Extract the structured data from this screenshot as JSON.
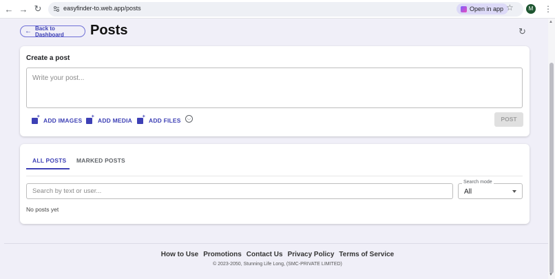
{
  "browser": {
    "url": "easyfinder-to.web.app/posts",
    "open_in_app": "Open in app",
    "avatar_letter": "M",
    "back_icon": "arrow-left-icon",
    "forward_icon": "arrow-right-icon",
    "reload_icon": "reload-icon"
  },
  "header": {
    "back_label": "Back to Dashboard",
    "title": "Posts"
  },
  "create_post": {
    "title": "Create a post",
    "placeholder": "Write your post...",
    "add_images": "ADD IMAGES",
    "add_media": "ADD MEDIA",
    "add_files": "ADD FILES",
    "post_label": "POST"
  },
  "posts": {
    "tabs": [
      {
        "label": "ALL POSTS",
        "active": true
      },
      {
        "label": "MARKED POSTS",
        "active": false
      }
    ],
    "search_placeholder": "Search by text or user...",
    "search_mode_label": "Search mode",
    "search_mode_value": "All",
    "empty_text": "No posts yet"
  },
  "footer": {
    "links": [
      "How to Use",
      "Promotions",
      "Contact Us",
      "Privacy Policy",
      "Terms of Service"
    ],
    "copyright": "© 2023-2050, Stunning Life Long, (SMC-PRIVATE LIMITED)"
  },
  "colors": {
    "accent": "#3d40b5",
    "page_bg": "#f0eff8",
    "disabled_button": "#e0e0e0"
  }
}
